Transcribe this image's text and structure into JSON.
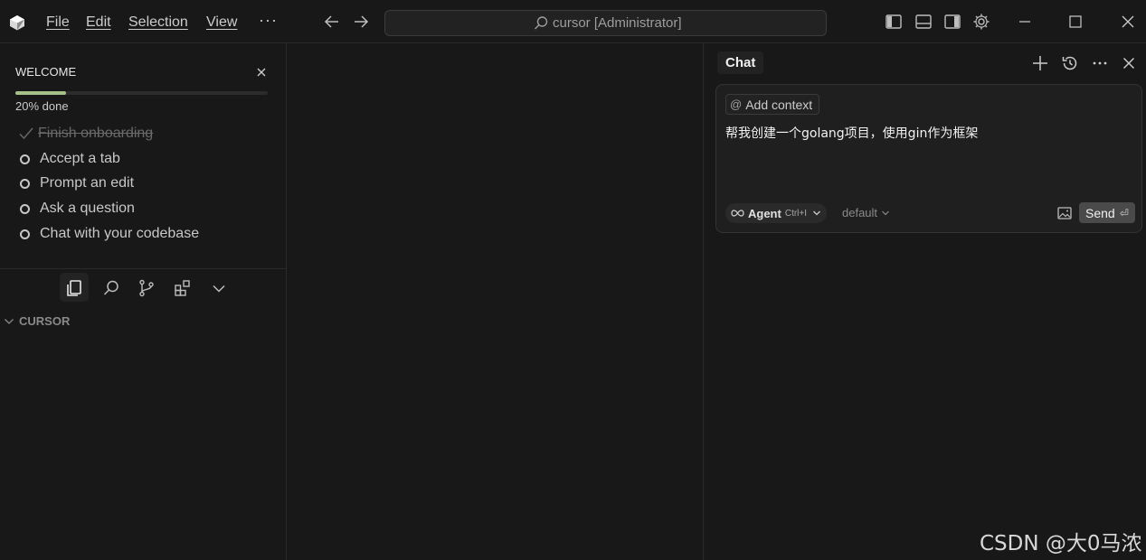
{
  "titlebar": {
    "menus": [
      "File",
      "Edit",
      "Selection",
      "View"
    ],
    "more": "···",
    "search_text": "cursor [Administrator]"
  },
  "welcome": {
    "title": "WELCOME",
    "progress_label": "20% done",
    "progress_fraction": 0.2,
    "steps": [
      {
        "label": "Finish onboarding",
        "done": true
      },
      {
        "label": "Accept a tab",
        "done": false
      },
      {
        "label": "Prompt an edit",
        "done": false
      },
      {
        "label": "Ask a question",
        "done": false
      },
      {
        "label": "Chat with your codebase",
        "done": false
      }
    ]
  },
  "explorer": {
    "section_title": "CURSOR"
  },
  "chat": {
    "tab_label": "Chat",
    "add_context_label": "Add context",
    "prompt_text": "帮我创建一个golang项目，使用gin作为框架",
    "agent_label": "Agent",
    "agent_shortcut": "Ctrl+I",
    "model_label": "default",
    "send_label": "Send",
    "send_key_glyph": "⏎"
  },
  "watermark": "CSDN @大0马浓",
  "colors": {
    "background": "#181818",
    "progress": "#a6c08a",
    "send_button": "#4a4a4a"
  }
}
